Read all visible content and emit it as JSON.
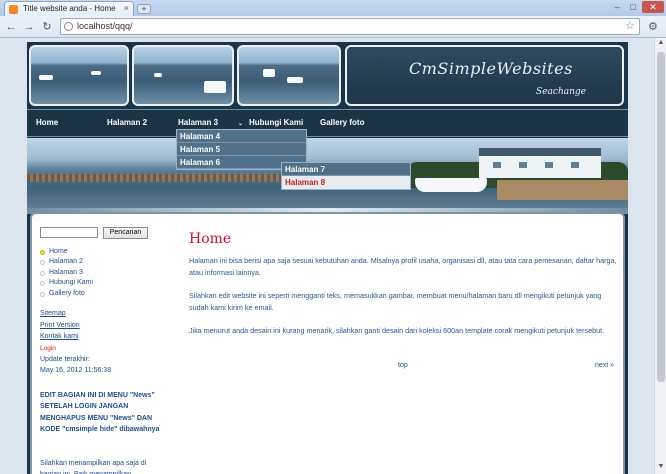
{
  "browser": {
    "tab_title": "Title website anda - Home",
    "tab_close": "×",
    "new_tab": "+",
    "controls": {
      "minimize": "–",
      "maximize": "□",
      "close": "✕"
    },
    "nav": {
      "back": "←",
      "forward": "→",
      "reload": "↻"
    },
    "url": "localhost/qqq/",
    "star": "☆",
    "wrench": "🔧"
  },
  "site": {
    "logo_title": "CmSimpleWebsites",
    "logo_subtitle": "Seachange",
    "nav": [
      {
        "label": "Home"
      },
      {
        "label": "Halaman 2"
      },
      {
        "label": "Halaman 3"
      },
      {
        "label": "Hubungi Kami"
      },
      {
        "label": "Gallery foto"
      }
    ],
    "caret": "⌄",
    "dropdown_1": [
      "Halaman 4",
      "Halaman 5",
      "Halaman 6"
    ],
    "dropdown_2": [
      "Halaman 7",
      "Halaman 8"
    ]
  },
  "sidebar": {
    "search_button": "Pencarian",
    "menu": [
      "Home",
      "Halaman 2",
      "Halaman 3",
      "Hubungi Kami",
      "Gallery foto"
    ],
    "sitemap": "Sitemap",
    "print_version": "Print Version",
    "contact": "Kontak kami",
    "login": "Login",
    "last_updated_label": "Update terakhir:",
    "last_updated_value": "May 16, 2012 11:56:38",
    "notice": "EDIT BAGIAN INI DI MENU \"News\" SETELAH LOGIN JANGAN MENGHAPUS MENU \"News\" DAN KODE \"cmsimple hide\" dibawahnya",
    "notice_2": "Silahkan menampilkan apa saja di bagian ini. Baik menampilkan"
  },
  "main": {
    "title": "Home",
    "paragraphs": [
      "Halaman ini bisa berisi apa saja sesuai kebutuhan anda. Misalnya profil usaha, organisasi dll, atau tata cara pemesanan, daftar harga, atau informasi lainnya.",
      "Silahkan edit website ini seperti mengganti teks, memasukkan gambar, membuat menu/halaman baru dll mengikuti petunjuk yang sudah kami kirim ke email.",
      "Jika menurut anda desain ini kurang menarik, silahkan ganti desain dari koleksi 600an template corak mengikuti petunjuk tersebut."
    ],
    "top_link": "top",
    "next_link": "next »"
  }
}
